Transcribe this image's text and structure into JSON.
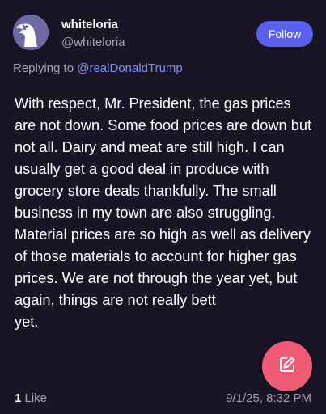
{
  "author": {
    "display_name": "whiteloria",
    "handle": "@whiteloria",
    "avatar_icon": "eagle-avatar-icon"
  },
  "follow_label": "Follow",
  "reply": {
    "prefix": "Replying to ",
    "mention": "@realDonaldTrump"
  },
  "post": {
    "text": "With respect, Mr. President, the gas prices are not down. Some food prices are down but not all. Dairy and meat are still high. I can usually get a good deal in produce with grocery store deals thankfully. The small business  in my town are also struggling. Material prices are so high as well as delivery of those materials to account for higher gas prices. We are not through the year yet, but again, things are not really bett\nyet."
  },
  "footer": {
    "like_count": "1",
    "like_label": " Like",
    "timestamp": "9/1/25, 8:32 PM"
  },
  "fab_icon": "compose-icon",
  "colors": {
    "background": "#191525",
    "accent": "#5a60ee",
    "mention": "#7d8dfb",
    "fab": "#ef5a75"
  }
}
